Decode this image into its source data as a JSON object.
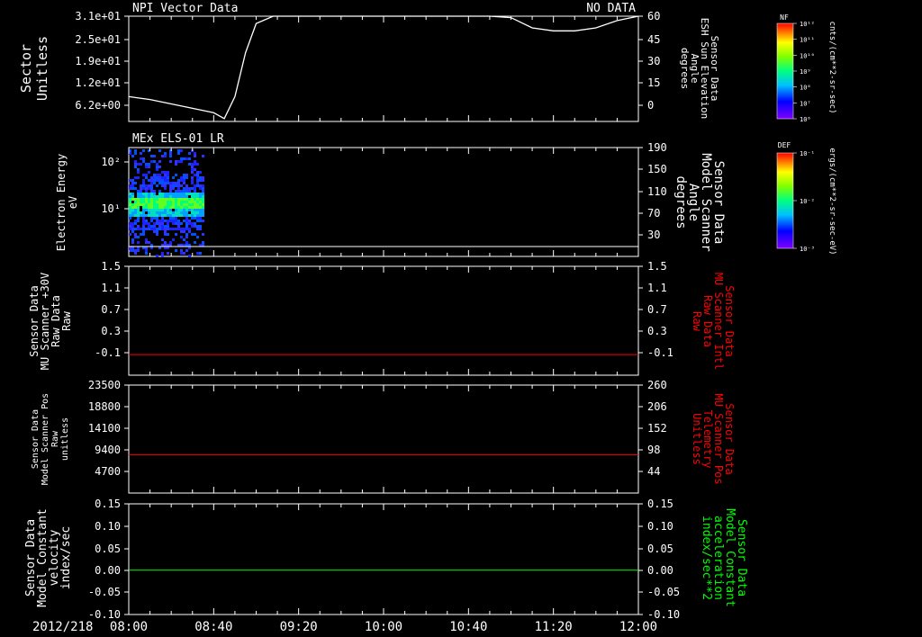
{
  "chart_data": [
    {
      "type": "line",
      "title": "NPI Vector Data",
      "title_right": "NO DATA",
      "ylabel": [
        "Sector",
        "Unitless"
      ],
      "ylabel2": [
        "Sensor Data",
        "ESH Sun Elevation",
        "Angle",
        "degrees"
      ],
      "yticks_left": [
        "3.1e+01",
        "2.5e+01",
        "1.9e+01",
        "1.2e+01",
        "6.2e+00"
      ],
      "yticks_right": [
        "60",
        "45",
        "30",
        "15",
        "0"
      ],
      "ylim_right": [
        -12,
        60
      ],
      "series": [
        {
          "x": [
            0,
            10,
            20,
            30,
            40,
            45,
            50,
            55,
            60,
            68,
            75,
            90,
            110,
            130,
            150,
            170,
            180,
            190,
            200,
            210,
            220,
            230,
            240
          ],
          "y": [
            5,
            3,
            0,
            -3,
            -6,
            -10,
            5,
            35,
            55,
            60,
            60,
            60,
            60,
            60,
            60,
            60,
            59,
            52,
            50,
            50,
            52,
            57,
            60
          ]
        }
      ]
    },
    {
      "type": "heatmap",
      "title": "MEx ELS-01 LR",
      "ylabel": [
        "Electron Energy",
        "eV"
      ],
      "yticks_left": [
        "10²",
        "10¹"
      ],
      "ylabel2": [
        "Sensor Data",
        "Model Scanner",
        "Angle",
        "degrees"
      ],
      "yticks_right": [
        "190",
        "150",
        "110",
        "70",
        "30"
      ],
      "ylim_right": [
        10,
        190
      ],
      "data_xrange": [
        0,
        35
      ],
      "energy_range_ev": [
        3,
        120
      ]
    },
    {
      "type": "line",
      "ylabel": [
        "Sensor Data",
        "MU Scanner +30V",
        "Raw Data",
        "Raw"
      ],
      "ylabel2": [
        "Sensor Data",
        "MU Scanner Intl",
        "Raw Data",
        "Raw"
      ],
      "yticks_left": [
        "1.5",
        "1.1",
        "0.7",
        "0.3",
        "-0.1"
      ],
      "yticks_right": [
        "1.5",
        "1.1",
        "0.7",
        "0.3",
        "-0.1"
      ],
      "ylim": [
        -0.35,
        1.5
      ],
      "series": [
        {
          "value": 0.0,
          "color": "#ff0000"
        }
      ]
    },
    {
      "type": "line",
      "ylabel": [
        "Sensor Data",
        "Model Scanner Pos",
        "Raw",
        "unitless"
      ],
      "ylabel2": [
        "Sensor Data",
        "MU Scanner Pos",
        "Telemetry",
        "Unitless"
      ],
      "yticks_left": [
        "23500",
        "18800",
        "14100",
        "9400",
        "4700"
      ],
      "yticks_right": [
        "260",
        "206",
        "152",
        "98",
        "44"
      ],
      "ylim": [
        0,
        23500
      ],
      "series": [
        {
          "value": 8300,
          "color": "#ff0000"
        }
      ]
    },
    {
      "type": "line",
      "ylabel": [
        "Sensor Data",
        "Model Constant",
        "velocity",
        "index/sec"
      ],
      "ylabel2": [
        "Sensor Data",
        "Model Constant",
        "acceleration",
        "index/sec**2"
      ],
      "yticks_left": [
        "0.15",
        "0.10",
        "0.05",
        "0.00",
        "-0.05",
        "-0.10"
      ],
      "yticks_right": [
        "0.15",
        "0.10",
        "0.05",
        "0.00",
        "-0.05",
        "-0.10"
      ],
      "ylim": [
        -0.1,
        0.15
      ],
      "series": [
        {
          "value": 0.0,
          "color": "#00ff00"
        }
      ]
    }
  ],
  "xaxis": {
    "date": "2012/218",
    "ticks": [
      "08:00",
      "08:40",
      "09:20",
      "10:00",
      "10:40",
      "11:20",
      "12:00"
    ],
    "xlim_minutes": [
      0,
      240
    ]
  },
  "colorbars": [
    {
      "label": "NF",
      "unit": "cnts/(cm**2-sr-sec)",
      "ticks": [
        "10¹²",
        "10¹¹",
        "10¹⁰",
        "10⁹",
        "10⁸",
        "10⁷",
        "10⁶"
      ]
    },
    {
      "label": "DEF",
      "unit": "ergs/(cm**2-sr-sec-eV)",
      "ticks": [
        "10⁻¹",
        "10⁻²",
        "10⁻³"
      ]
    }
  ],
  "colors": {
    "axis": "#ffffff",
    "red": "#ff0000",
    "green": "#00ff00",
    "bg": "#000000"
  }
}
